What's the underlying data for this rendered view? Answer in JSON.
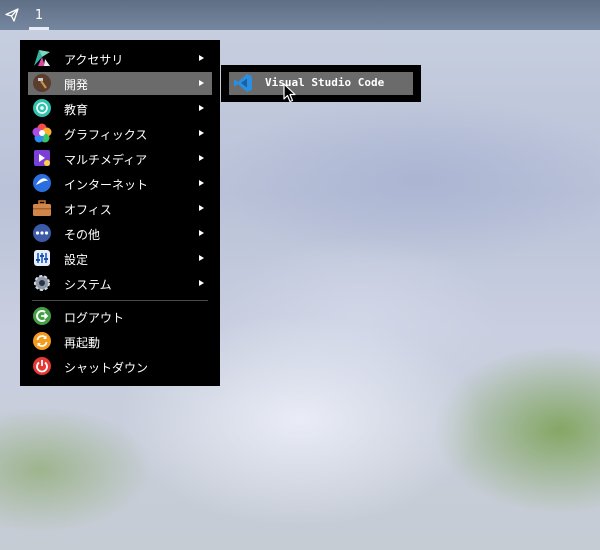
{
  "taskbar": {
    "launcher_icon": "paper-plane-icon",
    "workspace": "1"
  },
  "menu": {
    "items": [
      {
        "label": "アクセサリ",
        "icon": "accessories-icon",
        "submenu": true
      },
      {
        "label": "開発",
        "icon": "hammer-icon",
        "submenu": true,
        "active": true
      },
      {
        "label": "教育",
        "icon": "education-icon",
        "submenu": true
      },
      {
        "label": "グラフィックス",
        "icon": "graphics-icon",
        "submenu": true
      },
      {
        "label": "マルチメディア",
        "icon": "multimedia-icon",
        "submenu": true
      },
      {
        "label": "インターネット",
        "icon": "internet-icon",
        "submenu": true
      },
      {
        "label": "オフィス",
        "icon": "briefcase-icon",
        "submenu": true
      },
      {
        "label": "その他",
        "icon": "more-icon",
        "submenu": true
      },
      {
        "label": "設定",
        "icon": "settings-icon",
        "submenu": true
      },
      {
        "label": "システム",
        "icon": "gear-icon",
        "submenu": true
      }
    ],
    "session_items": [
      {
        "label": "ログアウト",
        "icon": "logout-icon"
      },
      {
        "label": "再起動",
        "icon": "restart-icon"
      },
      {
        "label": "シャットダウン",
        "icon": "power-icon"
      }
    ]
  },
  "submenu": {
    "items": [
      {
        "label": "Visual Studio Code",
        "icon": "vscode-icon"
      }
    ]
  },
  "colors": {
    "menu_bg": "#000000",
    "active_bg": "#6b6b6b",
    "vscode_blue": "#2b8fe0",
    "power_red": "#e53935",
    "restart_orange": "#f59a1b",
    "logout_green": "#43a047"
  }
}
